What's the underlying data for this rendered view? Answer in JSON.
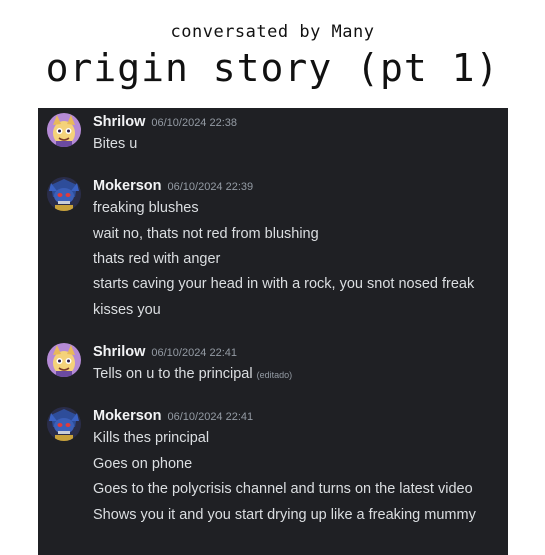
{
  "header": {
    "byline": "conversated by Many",
    "title": "origin story (pt 1)"
  },
  "messages": [
    {
      "author": "Shrilow",
      "timestamp": "06/10/2024 22:38",
      "avatar": "shrilow-avatar-icon",
      "lines": [
        "Bites u"
      ]
    },
    {
      "author": "Mokerson",
      "timestamp": "06/10/2024 22:39",
      "avatar": "mokerson-avatar-icon",
      "lines": [
        "freaking blushes",
        "wait no, thats not red from blushing",
        "thats red with anger",
        "starts caving your head in with a rock, you snot nosed freak",
        "kisses you"
      ]
    },
    {
      "author": "Shrilow",
      "timestamp": "06/10/2024 22:41",
      "avatar": "shrilow-avatar-icon",
      "lines": [
        "Tells on u to the principal"
      ],
      "edited_label": "(editado)"
    },
    {
      "author": "Mokerson",
      "timestamp": "06/10/2024 22:41",
      "avatar": "mokerson-avatar-icon",
      "lines": [
        "Kills thes principal",
        "Goes on phone",
        "Goes to the polycrisis channel and turns on the latest video",
        "Shows you it and you start drying up like a freaking mummy"
      ]
    }
  ],
  "colors": {
    "chat_background": "#1f2024",
    "author_name": "#f2f3f5",
    "message_text": "#dbdee1",
    "timestamp": "#949ba4"
  }
}
